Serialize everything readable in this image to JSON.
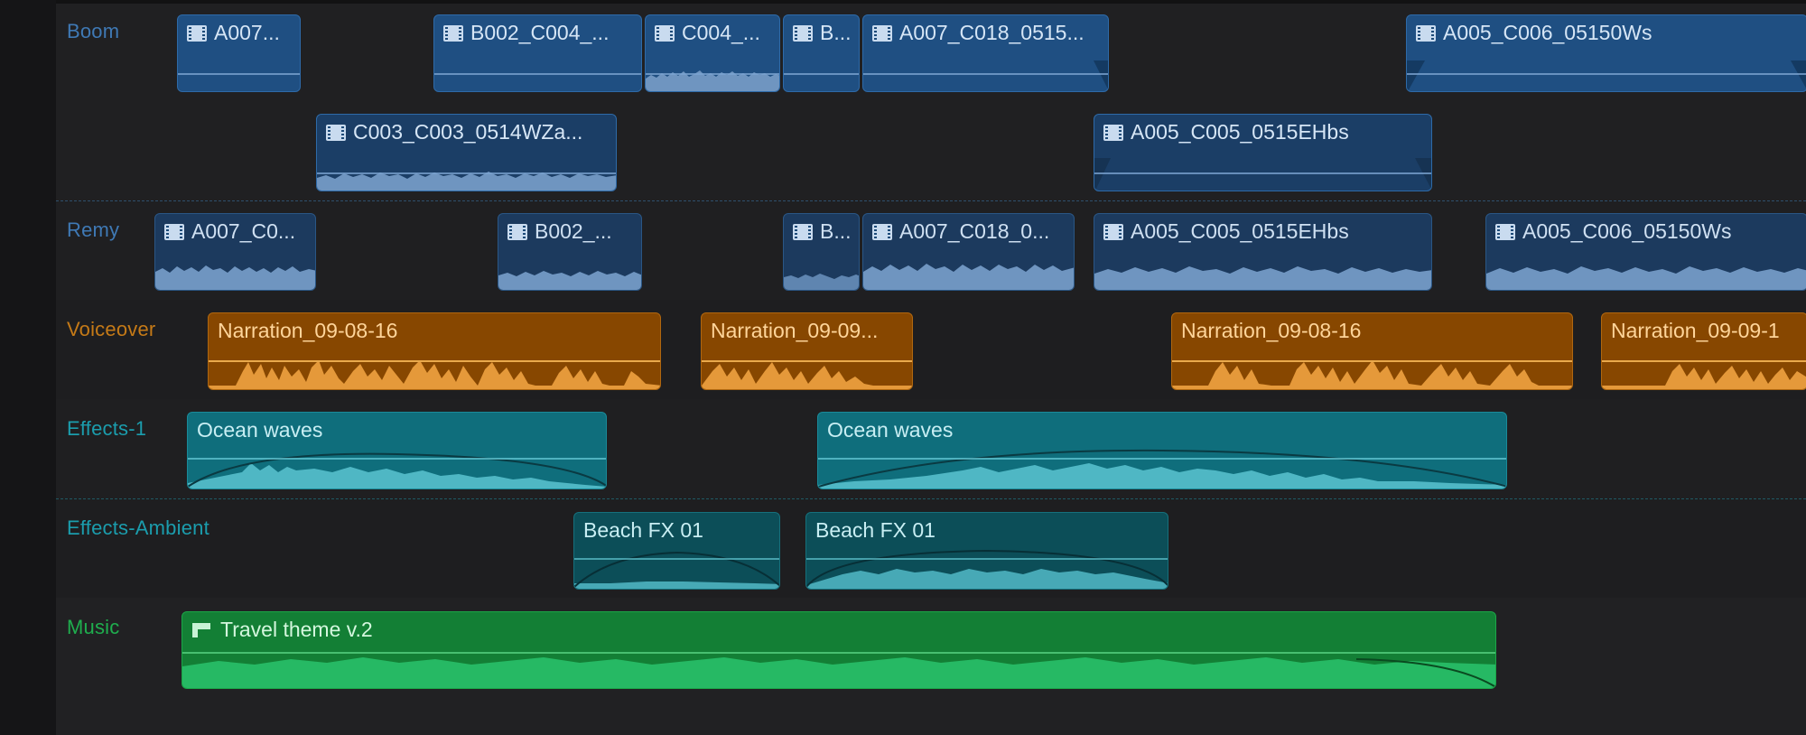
{
  "lanes": {
    "boom": {
      "label": "Boom",
      "color": "#2e6aa8"
    },
    "remy": {
      "label": "Remy",
      "color": "#2e6aa8"
    },
    "voiceover": {
      "label": "Voiceover",
      "color": "#b0670f"
    },
    "effects1": {
      "label": "Effects-1",
      "color": "#1a8a99"
    },
    "ambient": {
      "label": "Effects-Ambient",
      "color": "#1a8a99"
    },
    "music": {
      "label": "Music",
      "color": "#1ba648"
    }
  },
  "clips": {
    "boom_top": [
      "A007...",
      "B002_C004_...",
      "C004_...",
      "B...",
      "A007_C018_0515...",
      "A005_C006_05150Ws"
    ],
    "boom_bottom": [
      "C003_C003_0514WZa...",
      "A005_C005_0515EHbs"
    ],
    "remy": [
      "A007_C0...",
      "B002_...",
      "B...",
      "A007_C018_0...",
      "A005_C005_0515EHbs",
      "A005_C006_05150Ws"
    ],
    "voiceover": [
      "Narration_09-08-16",
      "Narration_09-09...",
      "Narration_09-08-16",
      "Narration_09-09-1"
    ],
    "effects1": [
      "Ocean waves",
      "Ocean waves"
    ],
    "ambient": [
      "Beach FX 01",
      "Beach FX 01"
    ],
    "music": [
      "Travel theme v.2"
    ]
  },
  "icons": {
    "video_clip": "film-icon",
    "music_clip": "music-clip-icon"
  }
}
